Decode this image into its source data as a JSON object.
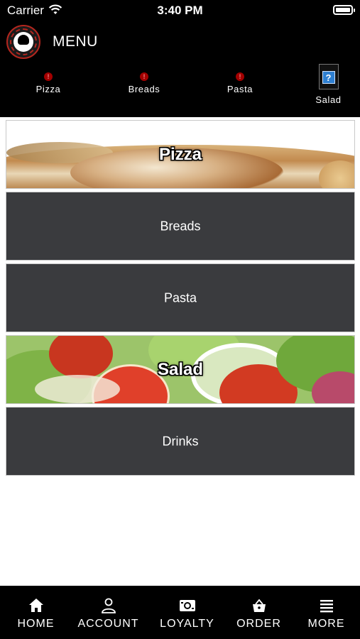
{
  "status_bar": {
    "carrier": "Carrier",
    "time": "3:40 PM"
  },
  "header": {
    "title": "MENU"
  },
  "category_strip": {
    "items": [
      {
        "label": "Pizza",
        "icon": "alert-dot-icon"
      },
      {
        "label": "Breads",
        "icon": "alert-dot-icon"
      },
      {
        "label": "Pasta",
        "icon": "alert-dot-icon"
      },
      {
        "label": "Salad",
        "icon": "question-image-icon",
        "icon_text": "?"
      }
    ]
  },
  "menu": {
    "items": [
      {
        "label": "Pizza",
        "style": "image"
      },
      {
        "label": "Breads",
        "style": "plain"
      },
      {
        "label": "Pasta",
        "style": "plain"
      },
      {
        "label": "Salad",
        "style": "image"
      },
      {
        "label": "Drinks",
        "style": "plain"
      }
    ]
  },
  "tab_bar": {
    "items": [
      {
        "label": "HOME",
        "icon": "home-icon"
      },
      {
        "label": "ACCOUNT",
        "icon": "user-icon"
      },
      {
        "label": "LOYALTY",
        "icon": "loyalty-ticket-icon"
      },
      {
        "label": "ORDER",
        "icon": "basket-icon"
      },
      {
        "label": "MORE",
        "icon": "hamburger-menu-icon"
      }
    ]
  },
  "colors": {
    "bar_background": "#000000",
    "tile_background": "#3a3b3e",
    "alert_dot": "#a30000",
    "question_icon": "#2e7fd1"
  }
}
